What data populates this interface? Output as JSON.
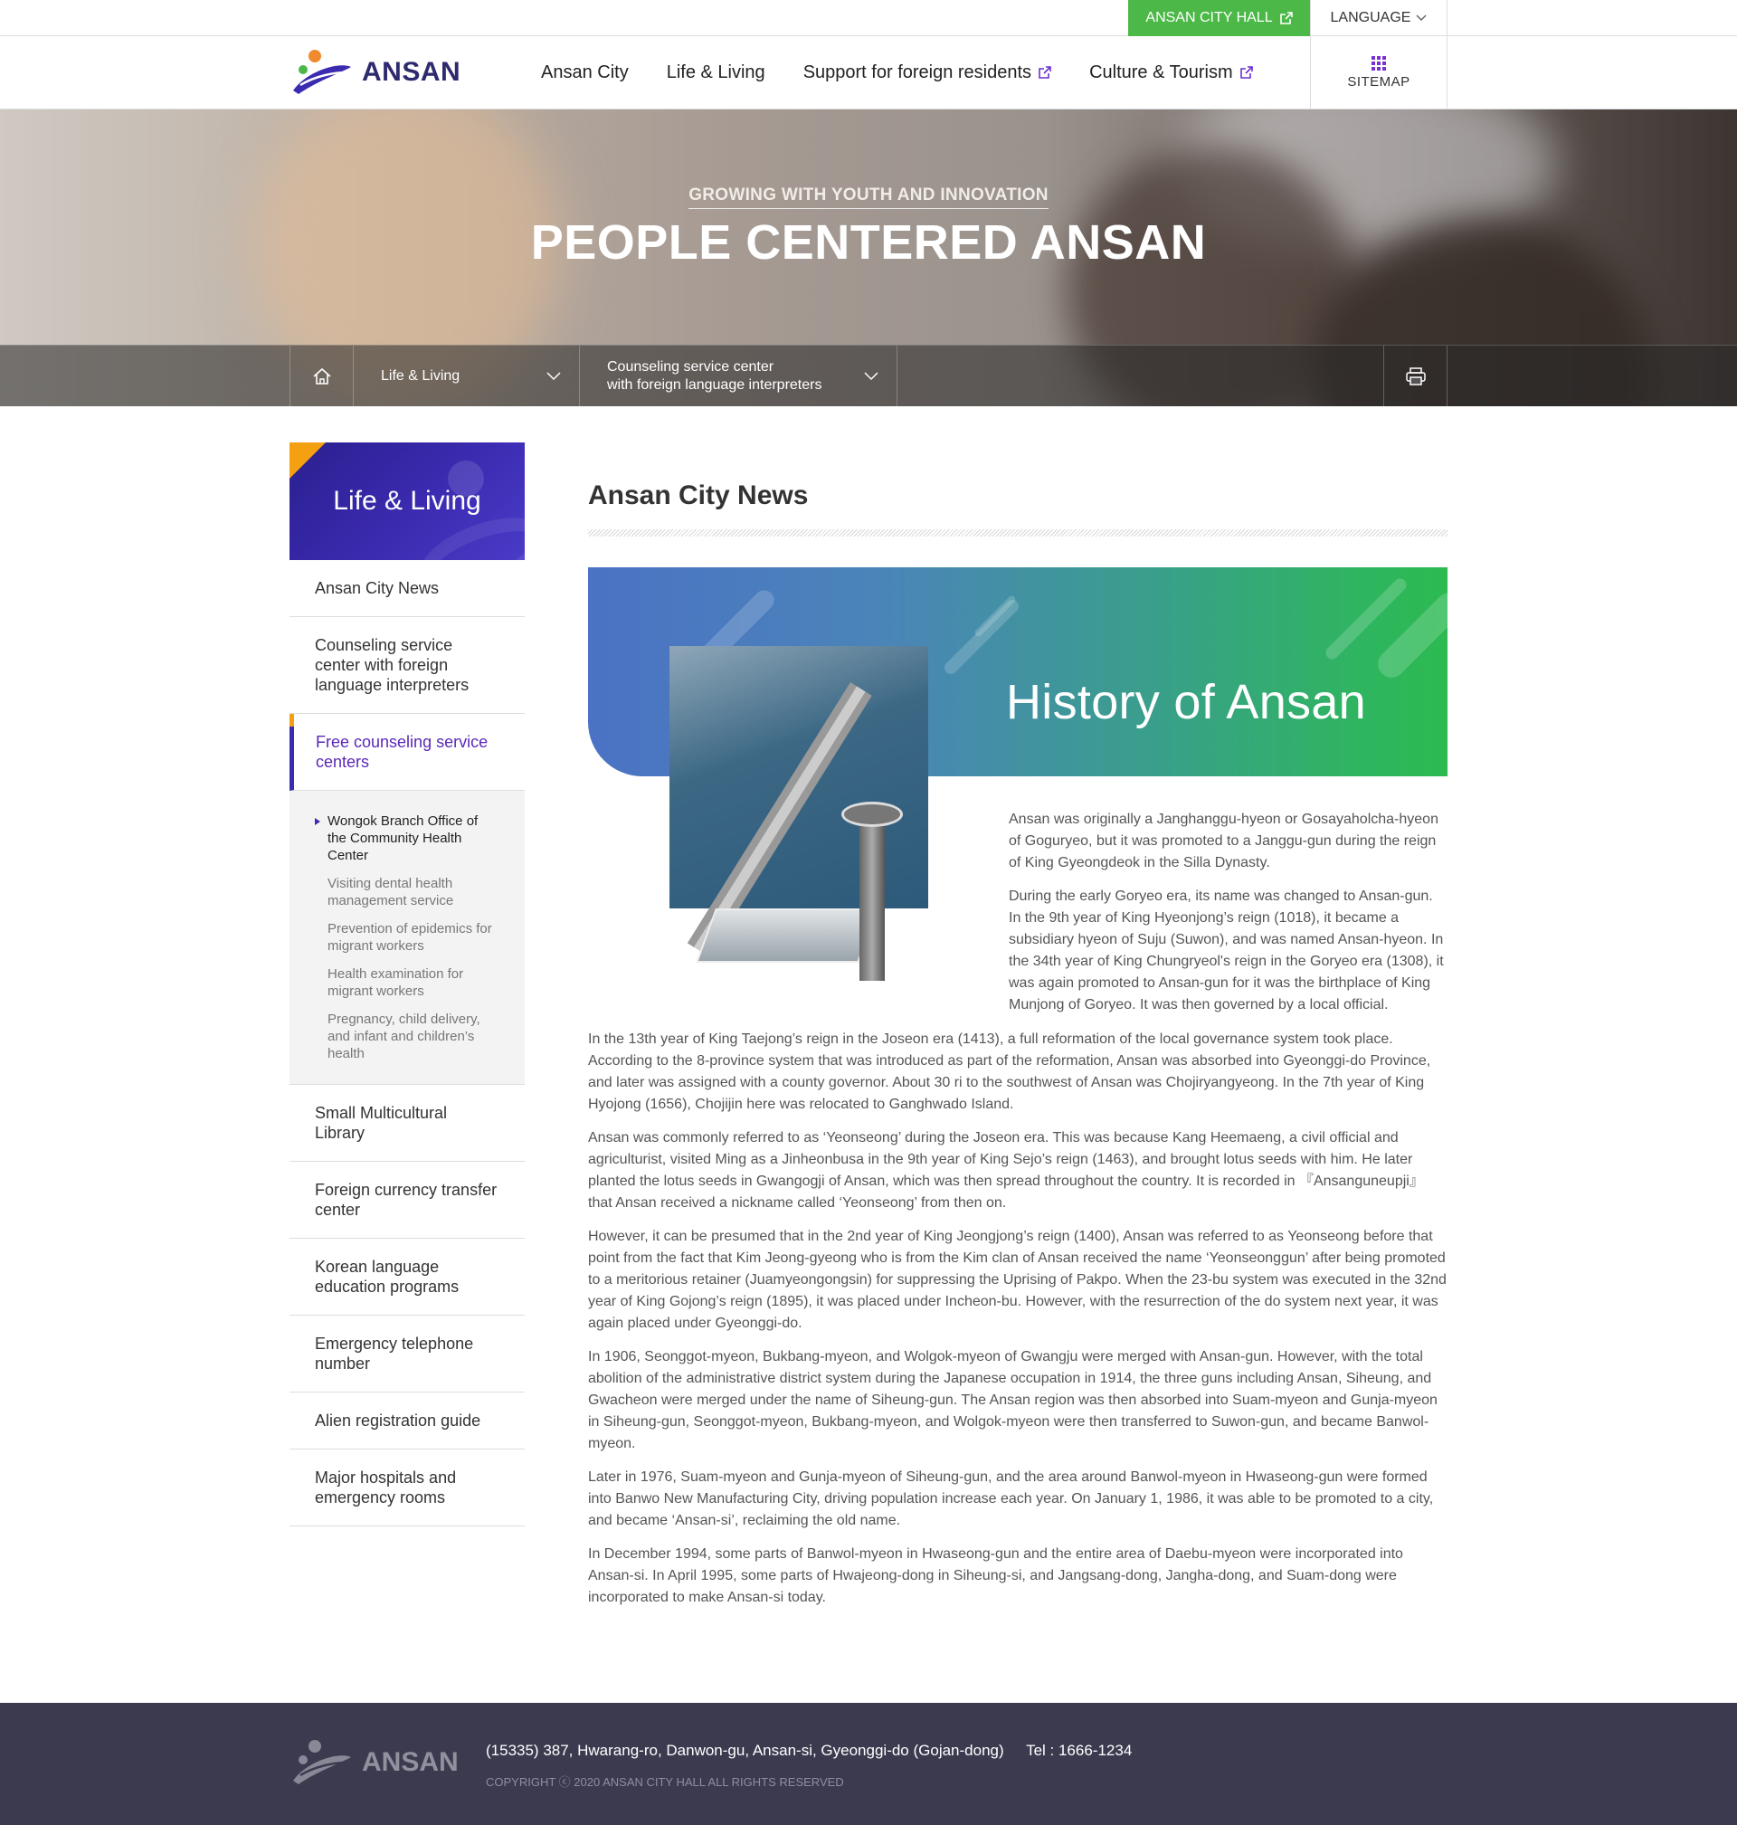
{
  "topbar": {
    "city_hall_label": "ANSAN CITY HALL",
    "language_label": "LANGUAGE"
  },
  "header": {
    "logo_text": "ANSAN",
    "nav": [
      {
        "label": "Ansan City",
        "external": false
      },
      {
        "label": "Life & Living",
        "external": false
      },
      {
        "label": "Support for foreign residents",
        "external": true
      },
      {
        "label": "Culture & Tourism",
        "external": true
      }
    ],
    "sitemap_label": "SITEMAP"
  },
  "hero": {
    "subtitle": "GROWING WITH YOUTH AND INNOVATION",
    "title": "PEOPLE CENTERED ANSAN"
  },
  "location": {
    "depth1": "Life & Living",
    "depth2_line1": "Counseling service center",
    "depth2_line2": "with foreign language interpreters"
  },
  "sidebar": {
    "title": "Life & Living",
    "items": [
      {
        "label": "Ansan City News"
      },
      {
        "label": "Counseling service center with foreign language interpreters"
      },
      {
        "label": "Free counseling service centers"
      },
      {
        "label": "Small Multicultural Library"
      },
      {
        "label": "Foreign currency transfer center"
      },
      {
        "label": "Korean language education programs"
      },
      {
        "label": "Emergency telephone number"
      },
      {
        "label": "Alien registration guide"
      },
      {
        "label": "Major hospitals and emergency rooms"
      }
    ],
    "sub_items": [
      {
        "label": "Wongok Branch Office of the Community Health Center"
      },
      {
        "label": "Visiting dental health management service"
      },
      {
        "label": "Prevention of epidemics for migrant workers"
      },
      {
        "label": "Health examination for migrant workers"
      },
      {
        "label": "Pregnancy, child delivery, and infant and children’s health"
      }
    ]
  },
  "content": {
    "page_title": "Ansan City News",
    "banner_title": "History of Ansan",
    "intro_paragraphs": [
      "Ansan was originally a Janghanggu-hyeon or Gosayaholcha-hyeon of Goguryeo, but it was promoted to a Janggu-gun during the reign of King Gyeongdeok in the Silla Dynasty.",
      "During the early Goryeo era, its name was changed to Ansan-gun. In the 9th year of King Hyeonjong’s reign (1018), it became a subsidiary hyeon of Suju (Suwon), and was named Ansan-hyeon. In the 34th year of King Chungryeol's reign in the Goryeo era (1308), it was again promoted to Ansan-gun for it was the birthplace of King Munjong of Goryeo. It was then governed by a local official."
    ],
    "paragraphs": [
      "In the 13th year of King Taejong’s reign in the Joseon era (1413), a full reformation of the local governance system took place. According to the 8-province system that was introduced as part of the reformation, Ansan was absorbed into Gyeonggi-do Province, and later was assigned with a county governor. About 30 ri to the southwest of Ansan was Chojiryangyeong. In the 7th year of King Hyojong (1656), Chojijin here was relocated to Ganghwado Island.",
      "Ansan was commonly referred to as ‘Yeonseong’ during the Joseon era. This was because Kang Heemaeng, a civil official and agriculturist, visited Ming as a Jinheonbusa in the 9th year of King Sejo’s reign (1463), and brought lotus seeds with him. He later planted the lotus seeds in Gwangogji of Ansan, which was then spread throughout the country. It is recorded in 『Ansanguneupji』 that Ansan received a nickname called ‘Yeonseong’ from then on.",
      "However, it can be presumed that in the 2nd year of King Jeongjong’s reign (1400), Ansan was referred to as Yeonseong before that point from the fact that Kim Jeong-gyeong who is from the Kim clan of Ansan received the name ‘Yeonseonggun’ after being promoted to a meritorious retainer (Juamyeongongsin) for suppressing the Uprising of Pakpo. When the 23-bu system was executed in the 32nd year of King Gojong’s reign (1895), it was placed under Incheon-bu. However, with the resurrection of the do system next year, it was again placed under Gyeonggi-do.",
      "In 1906, Seonggot-myeon, Bukbang-myeon, and Wolgok-myeon of Gwangju were merged with Ansan-gun. However, with the total abolition of the administrative district system during the Japanese occupation in 1914, the three guns including Ansan, Siheung, and Gwacheon were merged under the name of Siheung-gun. The Ansan region was then absorbed into Suam-myeon and Gunja-myeon in Siheung-gun, Seonggot-myeon, Bukbang-myeon, and Wolgok-myeon were then transferred to Suwon-gun, and became Banwol-myeon.",
      "Later in 1976, Suam-myeon and Gunja-myeon of Siheung-gun, and the area around Banwol-myeon in Hwaseong-gun were formed into Banwo New Manufacturing City, driving population increase each year. On January 1, 1986, it was able to be promoted to a city, and became ‘Ansan-si’, reclaiming the old name.",
      "In December 1994, some parts of Banwol-myeon in Hwaseong-gun and the entire area of Daebu-myeon were incorporated into Ansan-si. In April 1995, some parts of Hwajeong-dong in Siheung-si, and Jangsang-dong, Jangha-dong, and Suam-dong were incorporated to make Ansan-si today."
    ]
  },
  "footer": {
    "logo_text": "ANSAN",
    "address": "(15335) 387, Hwarang-ro, Danwon-gu, Ansan-si, Gyeonggi-do (Gojan-dong)",
    "tel": "Tel : 1666-1234",
    "copyright": "COPYRIGHT ⓒ 2020 ANSAN CITY HALL ALL RIGHTS RESERVED"
  },
  "colors": {
    "brand_navy": "#2d2a6e",
    "brand_purple": "#3b2bb0",
    "accent_green": "#4cb848",
    "accent_orange": "#f5a010",
    "footer_bg": "#3b3a4f"
  }
}
